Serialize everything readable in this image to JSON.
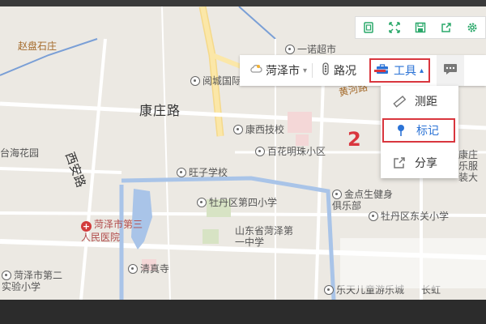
{
  "map": {
    "labels": {
      "zhao_pan_shi_zhuang": "赵盘石庄",
      "yi_nuo_supermarket": "一诺超市",
      "yue_cheng_guo_ji": "阅城国际",
      "kang_zhuang_road": "康庄路",
      "kang_xi_ji_xiao": "康西技校",
      "bai_hua_ming_zhu": "百花明珠小区",
      "tai_hai_hua_yuan": "台海花园",
      "xi_an_road": "西安路",
      "wang_zi_school": "旺子学校",
      "mu_dan_4th_middle": "牡丹区第四小学",
      "heze_3rd_hospital": "菏泽市第三人民医院",
      "shandong_heze_1st": "山东省菏泽第一中学",
      "jin_dian_sheng": "金点生健身俱乐部",
      "mudan_east_school": "牡丹区东关小学",
      "qing_zhen_si": "清真寺",
      "heze_2nd_school": "菏泽市第二实验小学",
      "kangzhuang_le_fu": "康庄乐服装大",
      "bottom_label": "乐天儿童游乐城",
      "bottom_label_2": "长虹",
      "river_label": "黄河路"
    }
  },
  "iconbar": {
    "icons": [
      "fit-screen-icon",
      "fullscreen-icon",
      "save-icon",
      "share-out-icon",
      "gear-icon"
    ]
  },
  "toolbar": {
    "city": "菏泽市",
    "traffic": "路况",
    "tools": "工具",
    "more_icon": "message-icon"
  },
  "dropdown": {
    "items": [
      {
        "label": "测距",
        "icon": "ruler-icon"
      },
      {
        "label": "标记",
        "icon": "pin-icon"
      },
      {
        "label": "分享",
        "icon": "share-icon"
      }
    ]
  },
  "annotation": {
    "step": "2"
  },
  "colors": {
    "accent": "#2b73d6",
    "highlight": "#d9363e",
    "map_bg": "#ece9e3"
  }
}
